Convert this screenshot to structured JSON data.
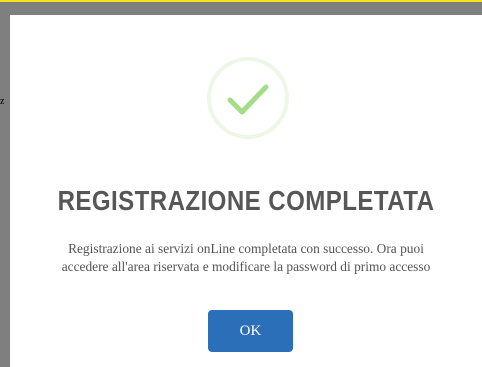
{
  "background": {
    "fragment_text": "z"
  },
  "dialog": {
    "icon": "checkmark-icon",
    "title": "REGISTRAZIONE COMPLETATA",
    "message_line1": "Registrazione ai servizi onLine completata con successo. Ora puoi",
    "message_line2": "accedere all'area riservata e modificare la password di primo accesso",
    "ok_label": "OK"
  },
  "colors": {
    "accent": "#2a6fb8",
    "success": "#a5dc86",
    "success_ring": "#eef6e6",
    "title": "#575757",
    "backdrop": "#7f7f7f",
    "top_strip": "#f2e21a"
  }
}
